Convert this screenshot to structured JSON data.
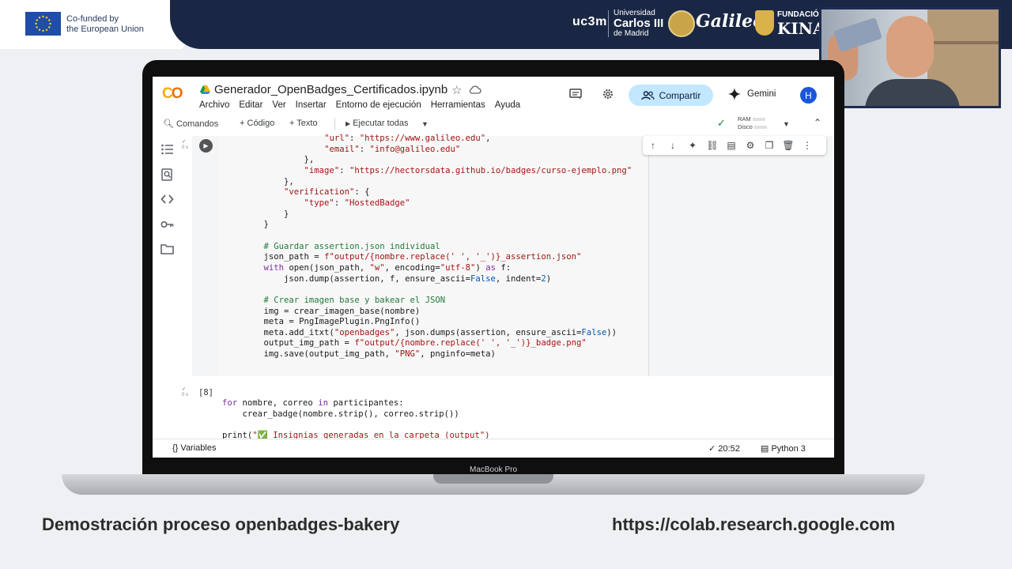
{
  "banner": {
    "eu_text_line1": "Co-funded by",
    "eu_text_line2": "the European Union",
    "uc3m": "uc3m",
    "univ_line1": "Universidad",
    "univ_line2": "Carlos III",
    "univ_line3": "de Madrid",
    "galileo": "Galileo",
    "fund_line1": "FUNDACIÓ",
    "fund_line2": "KINAI"
  },
  "laptop": {
    "model_label": "MacBook Pro"
  },
  "colab": {
    "notebook_title": "Generador_OpenBadges_Certificados.ipynb",
    "menu": [
      "Archivo",
      "Editar",
      "Ver",
      "Insertar",
      "Entorno de ejecución",
      "Herramientas",
      "Ayuda"
    ],
    "share_label": "Compartir",
    "gemini_label": "Gemini",
    "avatar_letter": "H",
    "toolbar": {
      "commands": "Comandos",
      "code": "Código",
      "text": "Texto",
      "run_all": "Ejecutar todas",
      "ram": "RAM",
      "disk": "Disco"
    },
    "cell1_exec": "0 s",
    "cell2_exec": "0 s",
    "cell2_number": "[8]",
    "status": {
      "variables": "Variables",
      "time": "20:52",
      "kernel": "Python 3"
    }
  },
  "captions": {
    "left": "Demostración proceso openbadges-bakery",
    "right": "https://colab.research.google.com"
  }
}
